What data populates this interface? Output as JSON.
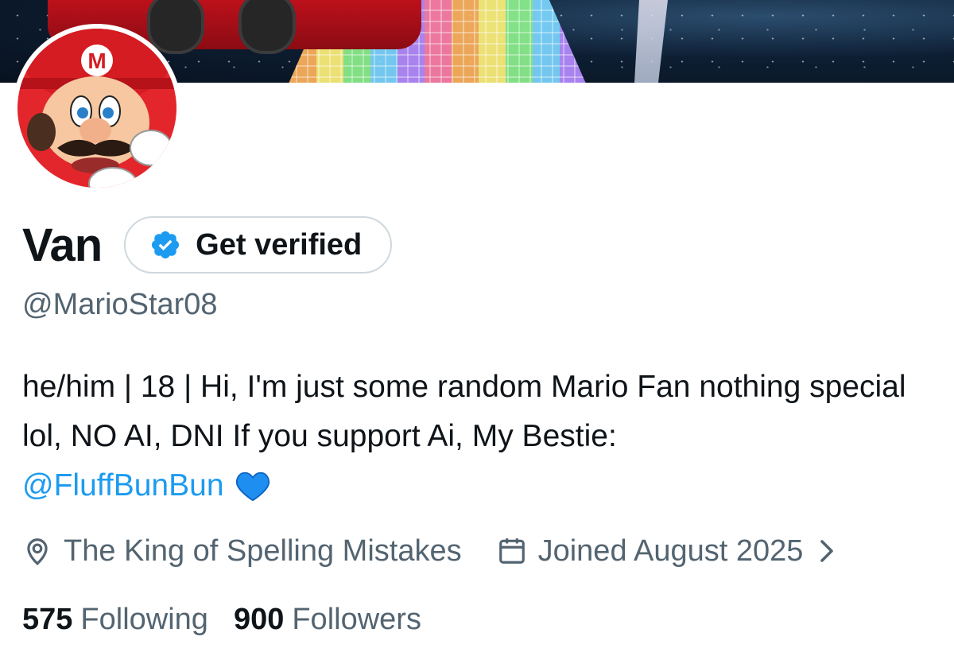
{
  "profile": {
    "display_name": "Van",
    "handle": "@MarioStar08",
    "verify_button": {
      "label": "Get verified",
      "icon": "verified-badge-icon",
      "color": "#1d9bf0"
    },
    "bio": {
      "text": "he/him | 18 | Hi, I'm just some random Mario Fan nothing special lol, NO AI, DNI If you support Ai, My Bestie:",
      "mention": "@FluffBunBun",
      "emoji": "blue-heart-icon"
    },
    "location": {
      "icon": "location-pin-icon",
      "text": "The King of Spelling Mistakes"
    },
    "joined": {
      "icon": "calendar-icon",
      "text": "Joined August 2025",
      "chevron_icon": "chevron-right-icon"
    },
    "stats": {
      "following": {
        "count": "575",
        "label": "Following"
      },
      "followers": {
        "count": "900",
        "label": "Followers"
      }
    }
  },
  "colors": {
    "text_primary": "#0f1419",
    "text_secondary": "#536471",
    "link": "#1d9bf0",
    "border": "#cfd9de"
  }
}
